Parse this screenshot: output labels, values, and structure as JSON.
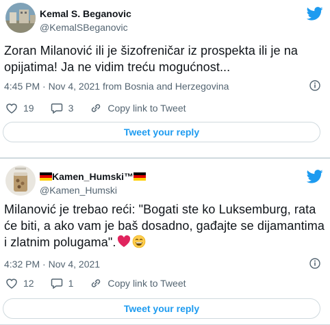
{
  "tweets": [
    {
      "author_name": "Kemal S. Beganovic",
      "handle": "@KemalSBeganovic",
      "text": "Zoran Milanović ili je šizofreničar iz prospekta ili je na opijatima! Ja ne vidim treću mogućnost...",
      "meta": "4:45 PM · Nov 4, 2021 from Bosnia and Herzegovina",
      "likes": "19",
      "replies": "3",
      "copy_link": "Copy link to Tweet",
      "reply_button": "Tweet your reply"
    },
    {
      "author_name": "Kamen_Humski™",
      "handle": "@Kamen_Humski",
      "text": "Milanović je trebao reći: \"Bogati ste ko Luksemburg, rata će biti, a ako vam je baš dosadno, gađajte se dijamantima i zlatnim polugama\".",
      "meta": "4:32 PM · Nov 4, 2021",
      "likes": "12",
      "replies": "1",
      "copy_link": "Copy link to Tweet",
      "reply_button": "Tweet your reply"
    }
  ],
  "colors": {
    "brand": "#1d9bf0",
    "secondary_text": "#536471",
    "border": "#cfd9de"
  }
}
